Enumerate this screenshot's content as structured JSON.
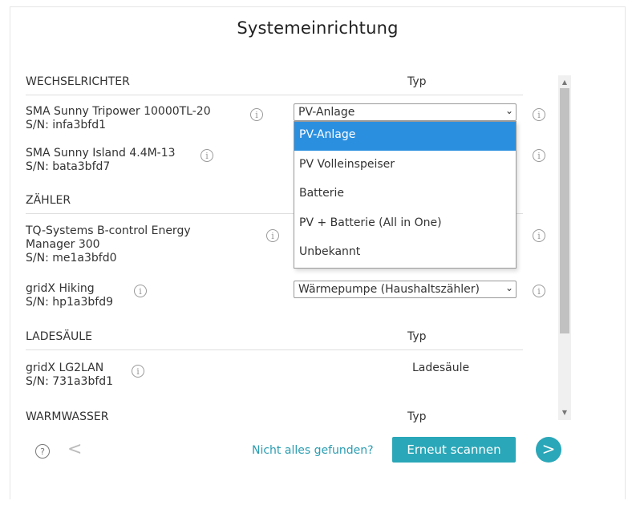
{
  "title": "Systemeinrichtung",
  "sections": {
    "inverter": {
      "heading": "WECHSELRICHTER",
      "type_label": "Typ"
    },
    "meter": {
      "heading": "ZÄHLER"
    },
    "charger": {
      "heading": "LADESÄULE",
      "type_label": "Typ"
    },
    "hotwater": {
      "heading": "WARMWASSER",
      "type_label": "Typ"
    }
  },
  "devices": {
    "inv1": {
      "name": "SMA Sunny Tripower 10000TL-20",
      "serial": "S/N: infa3bfd1",
      "type": "PV-Anlage"
    },
    "inv2": {
      "name": "SMA Sunny Island 4.4M-13",
      "serial": "S/N: bata3bfd7"
    },
    "meter1": {
      "name_line1": "TQ-Systems B-control Energy",
      "name_line2": "Manager 300",
      "serial": "S/N: me1a3bfd0"
    },
    "meter2": {
      "name": "gridX Hiking",
      "serial": "S/N: hp1a3bfd9",
      "type": "Wärmepumpe (Haushaltszähler)"
    },
    "charger1": {
      "name": "gridX LG2LAN",
      "serial": "S/N: 731a3bfd1",
      "type": "Ladesäule"
    }
  },
  "dropdown_options": [
    "PV-Anlage",
    "PV Volleinspeiser",
    "Batterie",
    "PV + Batterie (All in One)",
    "Unbekannt"
  ],
  "footer": {
    "not_found": "Nicht alles gefunden?",
    "rescan": "Erneut scannen",
    "help_glyph": "?",
    "back_glyph": "<",
    "next_glyph": ">"
  },
  "info_glyph": "i",
  "colors": {
    "accent": "#2aa7b8",
    "selection": "#2b8fe0",
    "link": "#2a9db1"
  }
}
